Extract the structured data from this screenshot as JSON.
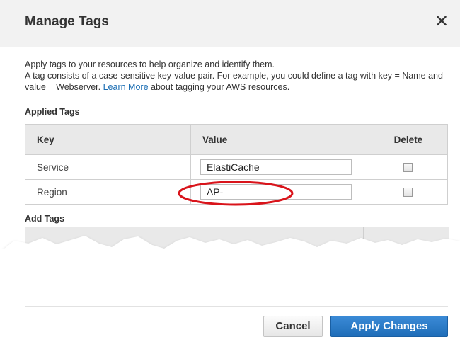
{
  "dialog": {
    "title": "Manage Tags",
    "close_glyph": "✕"
  },
  "description": {
    "line1": "Apply tags to your resources to help organize and identify them.",
    "line2_pre": "A tag consists of a case-sensitive key-value pair. For example, you could define a tag with key = Name and value = Webserver. ",
    "learn_more": "Learn More",
    "line2_post": " about tagging your AWS resources."
  },
  "applied_tags": {
    "heading": "Applied Tags",
    "columns": [
      "Key",
      "Value",
      "Delete"
    ],
    "rows": [
      {
        "key": "Service",
        "value": "ElastiCache",
        "delete": false
      },
      {
        "key": "Region",
        "value": "AP-",
        "delete": false
      }
    ]
  },
  "add_tags": {
    "heading": "Add Tags"
  },
  "buttons": {
    "cancel": "Cancel",
    "apply": "Apply Changes"
  },
  "colors": {
    "header_bg": "#f2f2f2",
    "primary_button": "#2a7cc7",
    "link": "#1a6db3",
    "highlight_ellipse": "#d9141b"
  },
  "icons": {
    "close": "close-icon"
  }
}
